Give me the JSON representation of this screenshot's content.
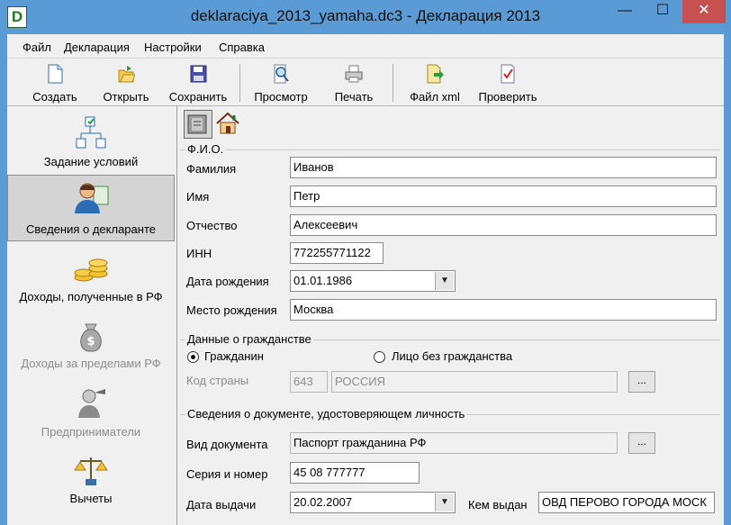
{
  "window": {
    "app_icon_letter": "D",
    "title": "deklaraciya_2013_yamaha.dc3 - Декларация 2013",
    "controls": {
      "minimize": "—",
      "maximize": "☐",
      "close": "✕"
    },
    "frame_color": "#5b9bd5"
  },
  "menu": [
    "Файл",
    "Декларация",
    "Настройки",
    "Справка"
  ],
  "toolbar": [
    {
      "label": "Создать",
      "icon": "new-document-icon"
    },
    {
      "label": "Открыть",
      "icon": "open-folder-icon"
    },
    {
      "label": "Сохранить",
      "icon": "save-disk-icon"
    },
    {
      "label": "Просмотр",
      "icon": "preview-magnifier-icon"
    },
    {
      "label": "Печать",
      "icon": "printer-icon"
    },
    {
      "label": "Файл xml",
      "icon": "xml-file-export-icon"
    },
    {
      "label": "Проверить",
      "icon": "check-document-icon"
    }
  ],
  "sidebar": [
    {
      "label": "Задание условий",
      "icon": "conditions-tree-icon",
      "selected": false,
      "disabled": false
    },
    {
      "label": "Сведения о декларанте",
      "icon": "person-card-icon",
      "selected": true,
      "disabled": false
    },
    {
      "label": "Доходы, полученные в РФ",
      "icon": "coins-icon",
      "selected": false,
      "disabled": false
    },
    {
      "label": "Доходы за пределами РФ",
      "icon": "money-bag-icon",
      "selected": false,
      "disabled": true
    },
    {
      "label": "Предприниматели",
      "icon": "entrepreneur-icon",
      "selected": false,
      "disabled": true
    },
    {
      "label": "Вычеты",
      "icon": "deductions-scales-icon",
      "selected": false,
      "disabled": false
    }
  ],
  "tabs": [
    {
      "icon": "personal-data-tab-icon",
      "active": true
    },
    {
      "icon": "house-address-tab-icon",
      "active": false
    }
  ],
  "fio": {
    "title": "Ф.И.О.",
    "surname_label": "Фамилия",
    "surname": "Иванов",
    "name_label": "Имя",
    "name": "Петр",
    "patronymic_label": "Отчество",
    "patronymic": "Алексеевич",
    "inn_label": "ИНН",
    "inn": "772255771122",
    "birthdate_label": "Дата рождения",
    "birthdate": "01.01.1986",
    "birthplace_label": "Место рождения",
    "birthplace": "Москва"
  },
  "citizenship": {
    "title": "Данные о гражданстве",
    "citizen_label": "Гражданин",
    "citizen_selected": true,
    "stateless_label": "Лицо без гражданства",
    "stateless_selected": false,
    "country_code_label": "Код страны",
    "country_code": "643",
    "country_name": "РОССИЯ",
    "browse": "..."
  },
  "document": {
    "title": "Сведения о документе, удостоверяющем личность",
    "type_label": "Вид документа",
    "type": "Паспорт гражданина РФ",
    "browse": "...",
    "series_label": "Серия и номер",
    "series": "45 08 777777",
    "issue_date_label": "Дата выдачи",
    "issue_date": "20.02.2007",
    "issued_by_label": "Кем выдан",
    "issued_by": "ОВД ПЕРОВО ГОРОДА МОСК"
  },
  "dropdown_arrow": "▼"
}
